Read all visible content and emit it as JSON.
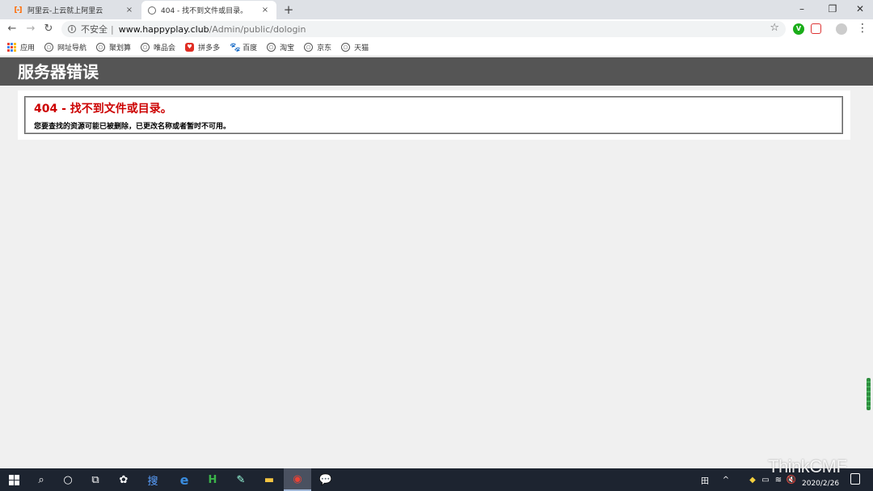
{
  "browser": {
    "tabs": [
      {
        "title": "阿里云-上云就上阿里云",
        "favicon": "aliyun-icon",
        "favicon_glyph": "[-]",
        "active": false
      },
      {
        "title": "404 - 找不到文件或目录。",
        "favicon": "globe-icon",
        "active": true
      }
    ],
    "new_tab_glyph": "+",
    "tab_close_glyph": "×",
    "window_controls": {
      "minimize": "–",
      "restore": "❐",
      "close": "✕"
    },
    "toolbar": {
      "back_glyph": "←",
      "forward_glyph": "→",
      "reload_glyph": "↻",
      "security_label": "不安全",
      "separator": "|",
      "url_host": "www.happyplay.club",
      "url_path": "/Admin/public/dologin",
      "bookmark_star_glyph": "☆",
      "menu_glyph": "⋮",
      "ext_green_glyph": "V"
    },
    "bookmarks": [
      {
        "label": "应用",
        "icon": "apps-icon"
      },
      {
        "label": "网址导航",
        "icon": "globe-icon"
      },
      {
        "label": "聚划算",
        "icon": "globe-icon"
      },
      {
        "label": "唯品会",
        "icon": "globe-icon"
      },
      {
        "label": "拼多多",
        "icon": "pinduoduo-icon"
      },
      {
        "label": "百度",
        "icon": "baidu-icon"
      },
      {
        "label": "淘宝",
        "icon": "globe-icon"
      },
      {
        "label": "京东",
        "icon": "globe-icon"
      },
      {
        "label": "天猫",
        "icon": "globe-icon"
      }
    ]
  },
  "page": {
    "header_title": "服务器错误",
    "error_title": "404 - 找不到文件或目录。",
    "error_message": "您要查找的资源可能已被删除，已更改名称或者暂时不可用。"
  },
  "taskbar": {
    "search_glyph": "⌕",
    "cortana_glyph": "○",
    "taskview_glyph": "⧉",
    "apps": [
      {
        "name": "fan-app-icon",
        "glyph": "✿"
      },
      {
        "name": "sogou-search-icon",
        "glyph": "搜"
      },
      {
        "name": "edge-icon",
        "glyph": "e"
      },
      {
        "name": "hbuilder-icon",
        "glyph": "H"
      },
      {
        "name": "notepad-icon",
        "glyph": "✎"
      },
      {
        "name": "file-explorer-icon",
        "glyph": "▬"
      },
      {
        "name": "chrome-icon",
        "glyph": "◉"
      },
      {
        "name": "wechat-icon",
        "glyph": "💬"
      }
    ],
    "tray": {
      "ime_glyph": "田",
      "up_arrow_glyph": "^",
      "wifi_glyph": "≋",
      "volume_glyph": "🔇"
    },
    "date": "2020/2/26"
  },
  "watermark": "ThinkCMF",
  "colors": {
    "header_bg": "#555555",
    "error_red": "#cc0000",
    "taskbar_bg": "#1d2430"
  }
}
